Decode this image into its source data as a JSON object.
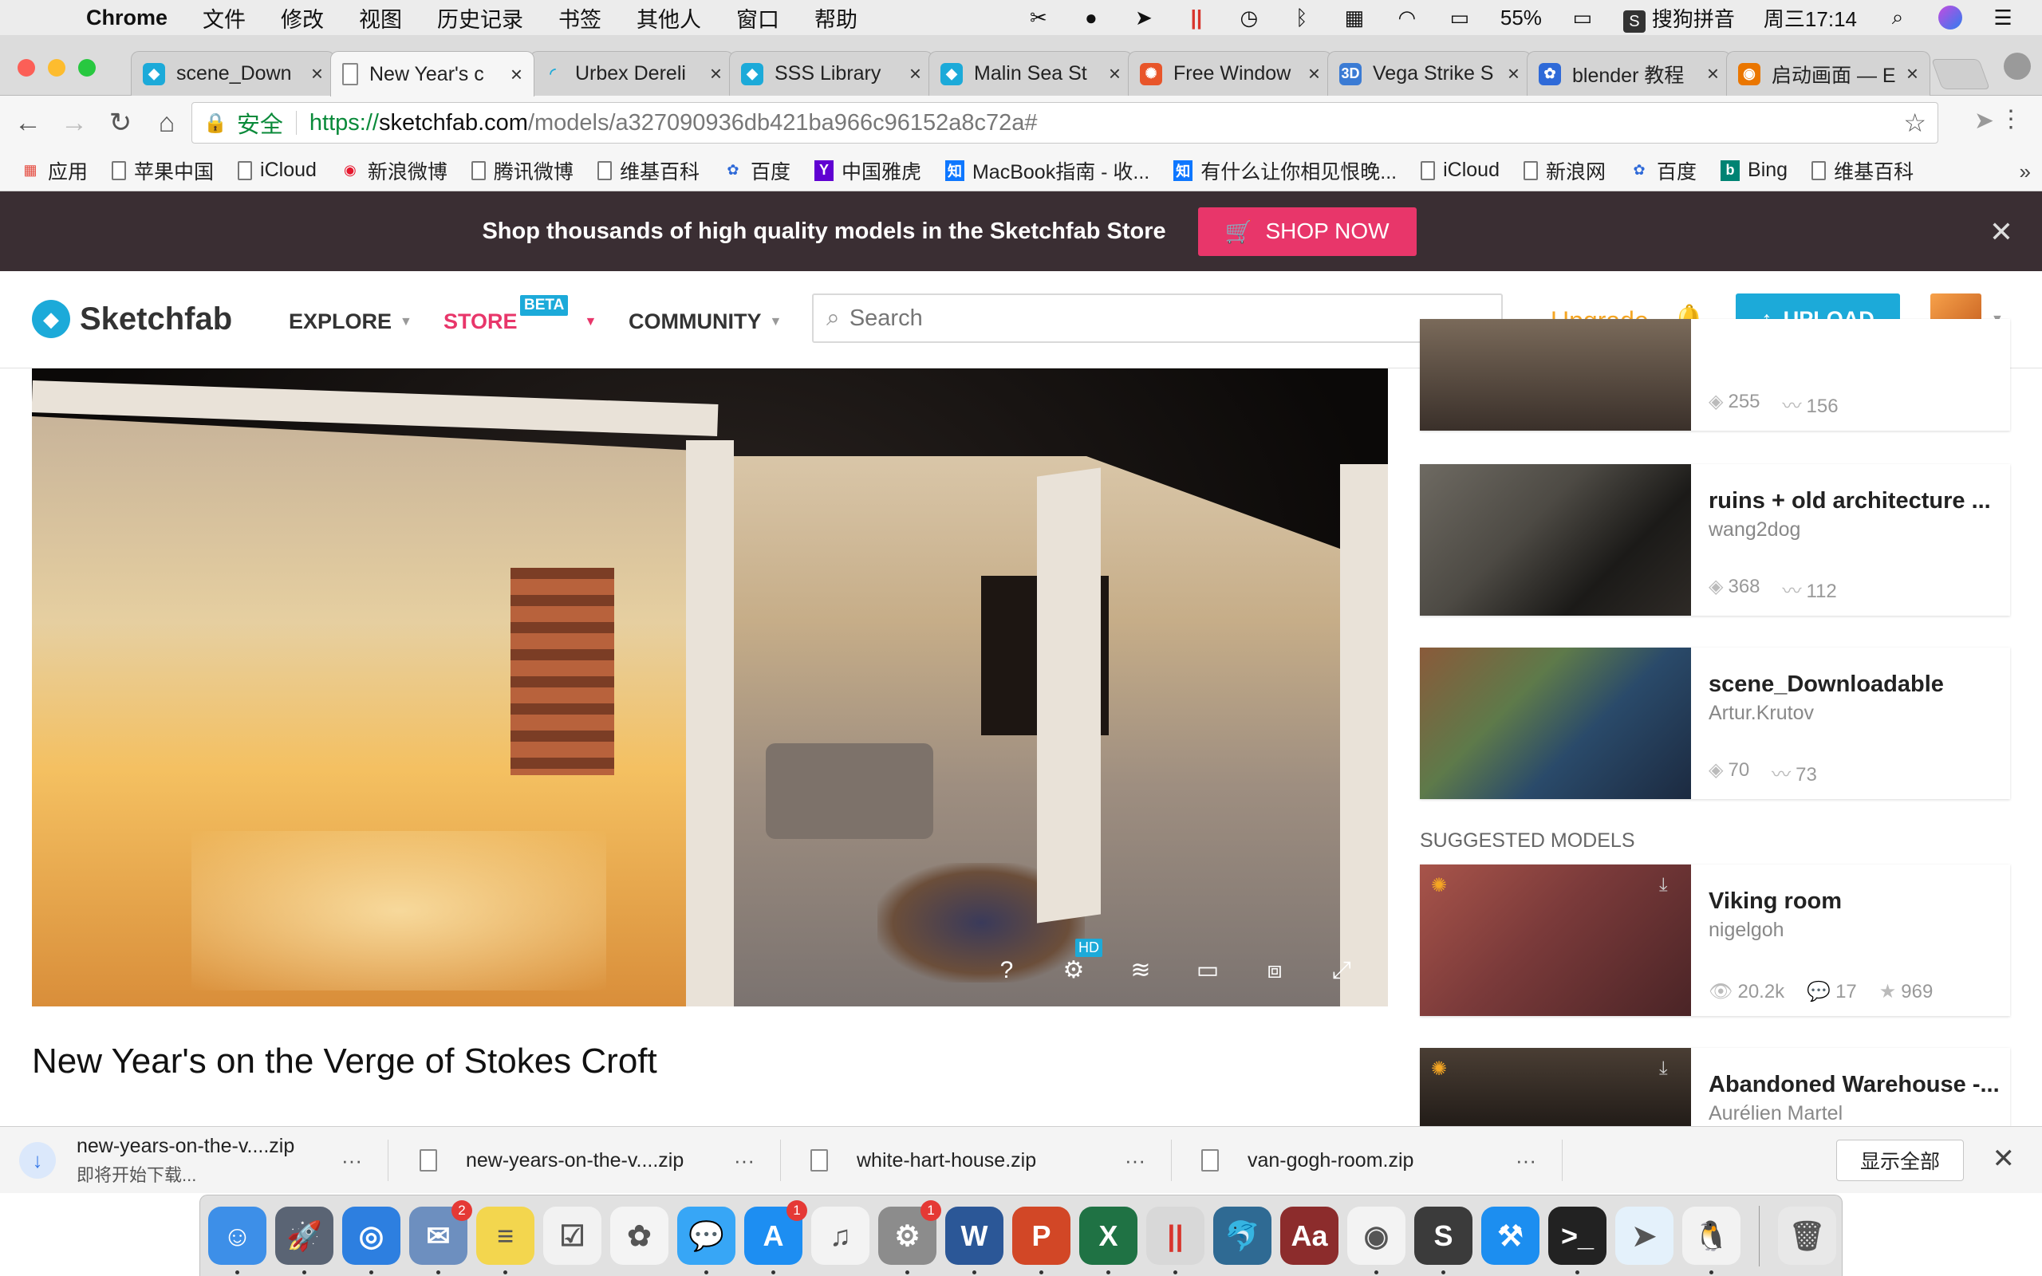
{
  "menubar": {
    "app_name": "Chrome",
    "menus": [
      "文件",
      "修改",
      "视图",
      "历史记录",
      "书签",
      "其他人",
      "窗口",
      "帮助"
    ],
    "battery": "55%",
    "input_method": "搜狗拼音",
    "clock": "周三17:14"
  },
  "tabs": [
    {
      "title": "scene_Down",
      "icon": "sketchfab-icon",
      "color": "#1caad9"
    },
    {
      "title": "New Year's c",
      "icon": "page-icon",
      "color": "#888888"
    },
    {
      "title": "Urbex Dereli",
      "icon": "loading-icon",
      "color": "#1caad9"
    },
    {
      "title": "SSS Library",
      "icon": "sketchfab-icon",
      "color": "#1caad9"
    },
    {
      "title": "Malin Sea St",
      "icon": "sketchfab-icon",
      "color": "#1caad9"
    },
    {
      "title": "Free Window",
      "icon": "pinwheel-icon",
      "color": "#e8552a"
    },
    {
      "title": "Vega Strike S",
      "icon": "3d-icon",
      "color": "#3b7bd4"
    },
    {
      "title": "blender 教程",
      "icon": "baidu-paw-icon",
      "color": "#2f6ad8"
    },
    {
      "title": "启动画面 — E",
      "icon": "blender-icon",
      "color": "#ea7600"
    }
  ],
  "address": {
    "secure_label": "安全",
    "url_proto": "https://",
    "url_host": "sketchfab.com",
    "url_path": "/models/a327090936db421ba966c96152a8c72a#"
  },
  "bookmarks": [
    {
      "label": "应用",
      "icon": "apps-grid-icon"
    },
    {
      "label": "苹果中国",
      "icon": "doc-icon"
    },
    {
      "label": "iCloud",
      "icon": "doc-icon"
    },
    {
      "label": "新浪微博",
      "icon": "weibo-icon"
    },
    {
      "label": "腾讯微博",
      "icon": "doc-icon"
    },
    {
      "label": "维基百科",
      "icon": "doc-icon"
    },
    {
      "label": "百度",
      "icon": "baidu-paw-icon"
    },
    {
      "label": "中国雅虎",
      "icon": "yahoo-icon"
    },
    {
      "label": "MacBook指南 - 收...",
      "icon": "zhihu-icon"
    },
    {
      "label": "有什么让你相见恨晚...",
      "icon": "zhihu-icon"
    },
    {
      "label": "iCloud",
      "icon": "doc-icon"
    },
    {
      "label": "新浪网",
      "icon": "doc-icon"
    },
    {
      "label": "百度",
      "icon": "baidu-paw-icon"
    },
    {
      "label": "Bing",
      "icon": "bing-icon"
    },
    {
      "label": "维基百科",
      "icon": "doc-icon"
    }
  ],
  "promo": {
    "text": "Shop thousands of high quality models in the Sketchfab Store",
    "button": "SHOP NOW"
  },
  "header": {
    "logo": "Sketchfab",
    "explore": "EXPLORE",
    "store": "STORE",
    "beta": "BETA",
    "community": "COMMUNITY",
    "search_placeholder": "Search",
    "upgrade": "Upgrade",
    "upload": "UPLOAD"
  },
  "viewer": {
    "hd": "HD",
    "help": "?"
  },
  "model": {
    "title": "New Year's on the Verge of Stokes Croft"
  },
  "sidebar": {
    "cards": [
      {
        "title": "",
        "author": "",
        "views": "",
        "likes": "",
        "stat1": "255",
        "stat2": "156"
      },
      {
        "title": "ruins + old architecture ...",
        "author": "wang2dog",
        "stat1": "368",
        "stat2": "112"
      },
      {
        "title": "scene_Downloadable",
        "author": "Artur.Krutov",
        "stat1": "70",
        "stat2": "73"
      }
    ],
    "suggested_label": "SUGGESTED MODELS",
    "suggested": [
      {
        "title": "Viking room",
        "author": "nigelgoh",
        "views": "20.2k",
        "comments": "17",
        "likes": "969"
      },
      {
        "title": "Abandoned Warehouse -...",
        "author": "Aurélien Martel"
      }
    ]
  },
  "downloads": {
    "items": [
      {
        "name": "new-years-on-the-v....zip",
        "status": "即将开始下载..."
      },
      {
        "name": "new-years-on-the-v....zip"
      },
      {
        "name": "white-hart-house.zip"
      },
      {
        "name": "van-gogh-room.zip"
      }
    ],
    "show_all": "显示全部"
  },
  "dock": {
    "apps": [
      {
        "name": "finder-icon",
        "color": "#3d8fe8"
      },
      {
        "name": "launchpad-icon",
        "color": "#5a6474"
      },
      {
        "name": "safari-icon",
        "color": "#2d7fe0"
      },
      {
        "name": "mail-icon",
        "color": "#6d8fbf",
        "badge": "2"
      },
      {
        "name": "notes-icon",
        "color": "#f3d64e"
      },
      {
        "name": "reminders-icon",
        "color": "#f2f2f2"
      },
      {
        "name": "photos-icon",
        "color": "#f4f4f4"
      },
      {
        "name": "messages-icon",
        "color": "#37a6f6"
      },
      {
        "name": "app-store-icon",
        "color": "#1d8ef2",
        "badge": "1"
      },
      {
        "name": "itunes-icon",
        "color": "#f3f3f3"
      },
      {
        "name": "system-preferences-icon",
        "color": "#8c8c8c",
        "badge": "1"
      },
      {
        "name": "word-icon",
        "color": "#2b5797"
      },
      {
        "name": "powerpoint-icon",
        "color": "#d24726"
      },
      {
        "name": "excel-icon",
        "color": "#1f7244"
      },
      {
        "name": "parallels-icon",
        "color": "#d8d8d8"
      },
      {
        "name": "mysql-workbench-icon",
        "color": "#2f6a93"
      },
      {
        "name": "dictionary-icon",
        "color": "#8c2c2c"
      },
      {
        "name": "chrome-icon",
        "color": "#f3f3f3"
      },
      {
        "name": "sublime-text-icon",
        "color": "#3b3b3b"
      },
      {
        "name": "xcode-icon",
        "color": "#1c8ef0"
      },
      {
        "name": "terminal-icon",
        "color": "#222222"
      },
      {
        "name": "sparrow-icon",
        "color": "#e4f1fb"
      },
      {
        "name": "qq-icon",
        "color": "#f2f2f2"
      },
      {
        "name": "trash-icon",
        "color": "#e8e8e8"
      }
    ],
    "word_letter": "W",
    "ppt_letter": "P",
    "excel_letter": "X"
  }
}
